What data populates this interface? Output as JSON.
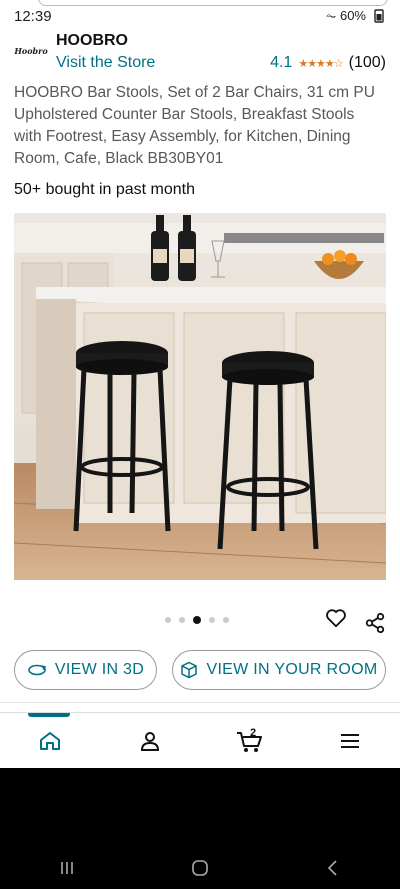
{
  "status": {
    "time": "12:39",
    "right_text": "⏦ 60%"
  },
  "brand": {
    "logo_text": "Hoobro",
    "name": "HOOBRO",
    "visit_store": "Visit the Store"
  },
  "rating": {
    "score": "4.1",
    "stars": 4.1,
    "count": "(100)"
  },
  "product": {
    "title": "HOOBRO Bar Stools, Set of 2 Bar Chairs, 31 cm PU Upholstered Counter Bar Stools, Breakfast Stools with Footrest, Easy Assembly, for Kitchen, Dining Room, Cafe, Black BB30BY01",
    "bought": "50+ bought in past month"
  },
  "carousel": {
    "total": 5,
    "active_index": 2
  },
  "actions": {
    "view_3d": "VIEW IN 3D",
    "view_room": "VIEW IN YOUR ROOM"
  },
  "bottom_nav": {
    "cart_count": "2",
    "items": [
      "home-icon",
      "account-icon",
      "cart-icon",
      "menu-icon"
    ]
  },
  "colors": {
    "link": "#007185",
    "star": "#de7921",
    "text": "#0f1111",
    "muted": "#565959"
  }
}
